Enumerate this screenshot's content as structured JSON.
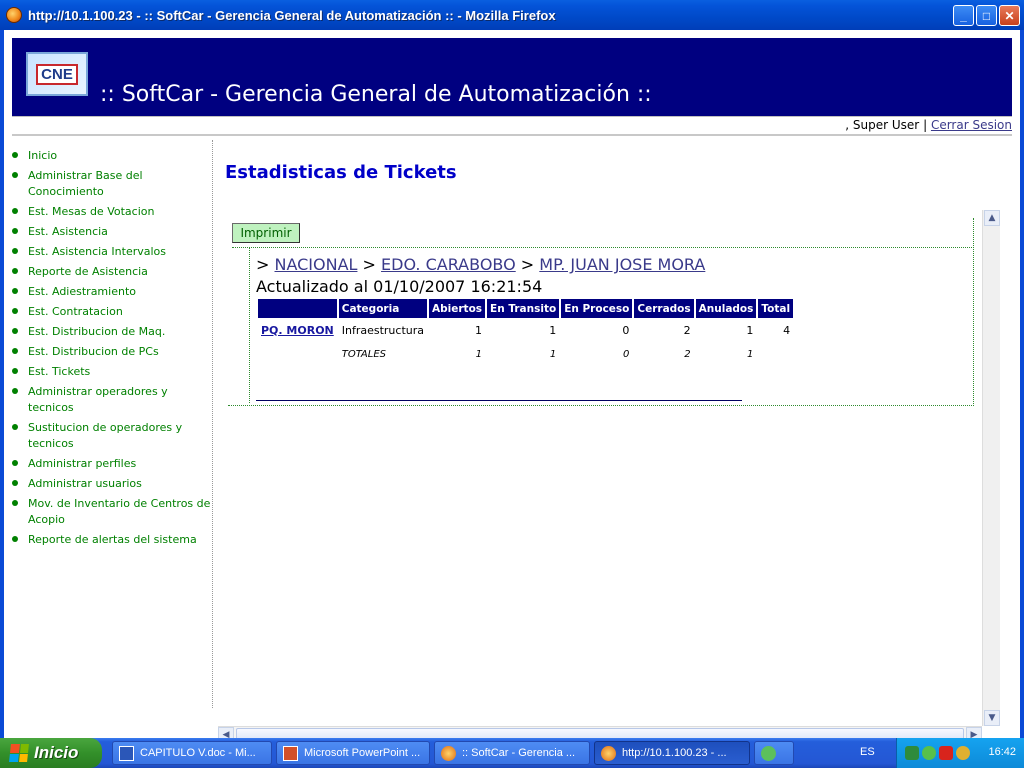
{
  "window": {
    "title": "http://10.1.100.23 - :: SoftCar - Gerencia General de Automatización :: - Mozilla Firefox",
    "minimize": "_",
    "maximize": "□",
    "close": "✕"
  },
  "header": {
    "logo_text": "CNE",
    "site_title": ":: SoftCar - Gerencia General de Automatización ::"
  },
  "userbar": {
    "user": ", Super User",
    "separator": "|",
    "logout": "Cerrar Sesion"
  },
  "sidebar": {
    "items": [
      "Inicio",
      "Administrar Base del Conocimiento",
      "Est. Mesas de Votacion",
      "Est. Asistencia",
      "Est. Asistencia Intervalos",
      "Reporte de Asistencia",
      "Est. Adiestramiento",
      "Est. Contratacion",
      "Est. Distribucion de Maq.",
      "Est. Distribucion de PCs",
      "Est. Tickets",
      "Administrar operadores y tecnicos",
      "Sustitucion de operadores y tecnicos",
      "Administrar perfiles",
      "Administrar usuarios",
      "Mov. de Inventario de Centros de Acopio",
      "Reporte de alertas del sistema"
    ]
  },
  "main": {
    "title": "Estadisticas de Tickets",
    "print_button": "Imprimir",
    "breadcrumb": {
      "sep": ">",
      "level1": "NACIONAL",
      "level2": "EDO. CARABOBO",
      "level3": "MP. JUAN JOSE MORA"
    },
    "updated": "Actualizado al 01/10/2007 16:21:54",
    "table": {
      "headers": [
        "",
        "Categoria",
        "Abiertos",
        "En Transito",
        "En Proceso",
        "Cerrados",
        "Anulados",
        "Total"
      ],
      "rows": [
        {
          "place": "PQ. MORON",
          "category": "Infraestructura",
          "abiertos": "1",
          "transito": "1",
          "proceso": "0",
          "cerrados": "2",
          "anulados": "1",
          "total": "4"
        }
      ],
      "totals": {
        "label": "TOTALES",
        "abiertos": "1",
        "transito": "1",
        "proceso": "0",
        "cerrados": "2",
        "anulados": "1"
      }
    }
  },
  "taskbar": {
    "start": "Inicio",
    "tasks": [
      "CAPITULO V.doc - Mi...",
      "Microsoft PowerPoint ...",
      ":: SoftCar - Gerencia ...",
      "http://10.1.100.23 - ..."
    ],
    "lang": "ES",
    "clock": "16:42"
  }
}
